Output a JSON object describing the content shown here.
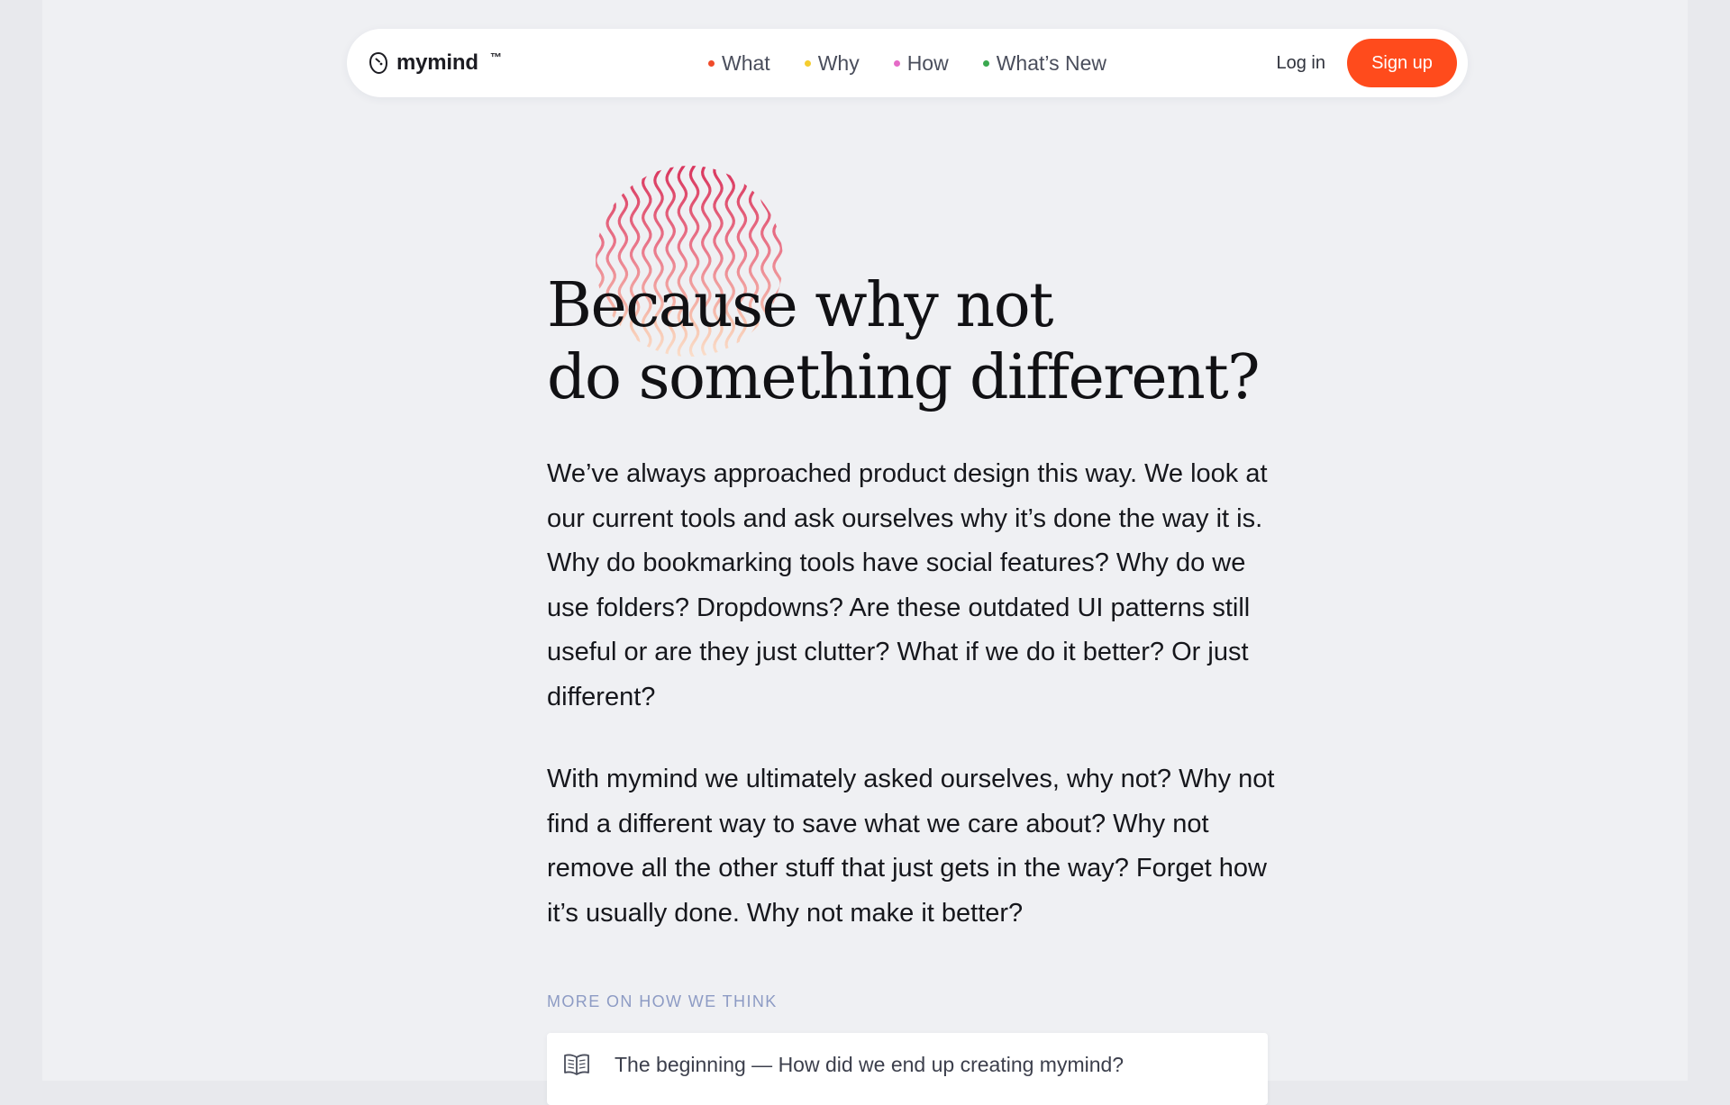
{
  "colors": {
    "accent": "#ff4b1c",
    "page_background": "#eff0f3",
    "section_label": "#8d9bc4"
  },
  "brand": {
    "logo_icon": "mind-logo-icon",
    "name": "mymind",
    "trademark": "™"
  },
  "nav": {
    "links": [
      {
        "label": "What",
        "dot_color": "#f04b2a"
      },
      {
        "label": "Why",
        "dot_color": "#f5cd2e"
      },
      {
        "label": "How",
        "dot_color": "#e56bc7"
      },
      {
        "label": "What’s New",
        "dot_color": "#3aa84f"
      }
    ],
    "login_label": "Log in",
    "signup_label": "Sign up"
  },
  "hero": {
    "decoration_icon": "wavy-gradient-blob",
    "headline_line1": "Because why not",
    "headline_line2": "do something different?"
  },
  "body": {
    "paragraph1": "We’ve always approached product design this way. We look at our current tools and ask ourselves why it’s done the way it is. Why do bookmarking tools have social features? Why do we use folders? Dropdowns? Are these outdated UI patterns still useful or are they just clutter? What if we do it better? Or just different?",
    "paragraph2": "With mymind we ultimately asked ourselves, why not? Why not find a different way to save what we care about? Why not remove all the other stuff that just gets in the way? Forget how it’s usually done. Why not make it better?"
  },
  "more": {
    "section_label": "MORE ON HOW WE THINK",
    "items": [
      {
        "icon": "open-book-icon",
        "title": "The beginning — How did we end up creating mymind?"
      }
    ]
  }
}
